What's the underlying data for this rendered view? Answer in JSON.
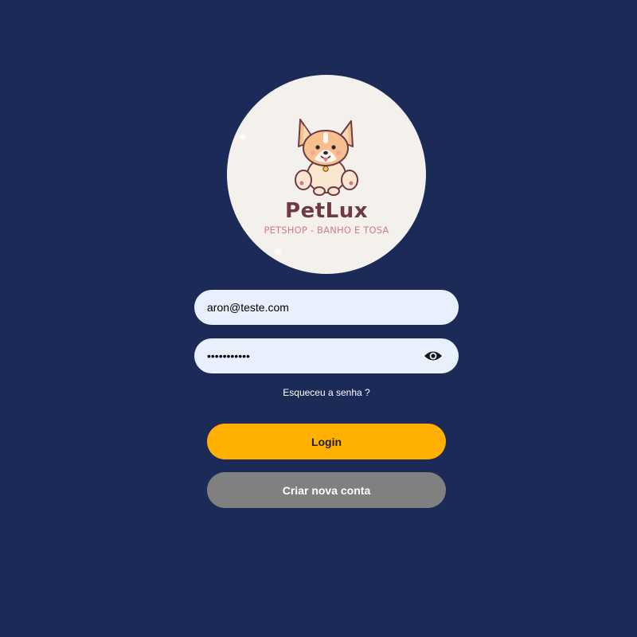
{
  "logo": {
    "brand_name": "PetLux",
    "tagline": "PETSHOP - BANHO E TOSA",
    "mascot_icon": "corgi-mascot-icon",
    "brand_color": "#6e3a44",
    "tagline_color": "#d17d88",
    "circle_color": "#f4f0eb"
  },
  "login_form": {
    "email_value": "aron@teste.com",
    "password_value": "•••••••••••",
    "password_toggle_icon": "eye-icon",
    "forgot_password_label": "Esqueceu a senha ?",
    "login_label": "Login",
    "create_account_label": "Criar nova conta"
  },
  "colors": {
    "background": "#1b2a57",
    "input_background": "#e8f0fe",
    "login_button": "#ffb000",
    "create_account_button": "#808080"
  }
}
